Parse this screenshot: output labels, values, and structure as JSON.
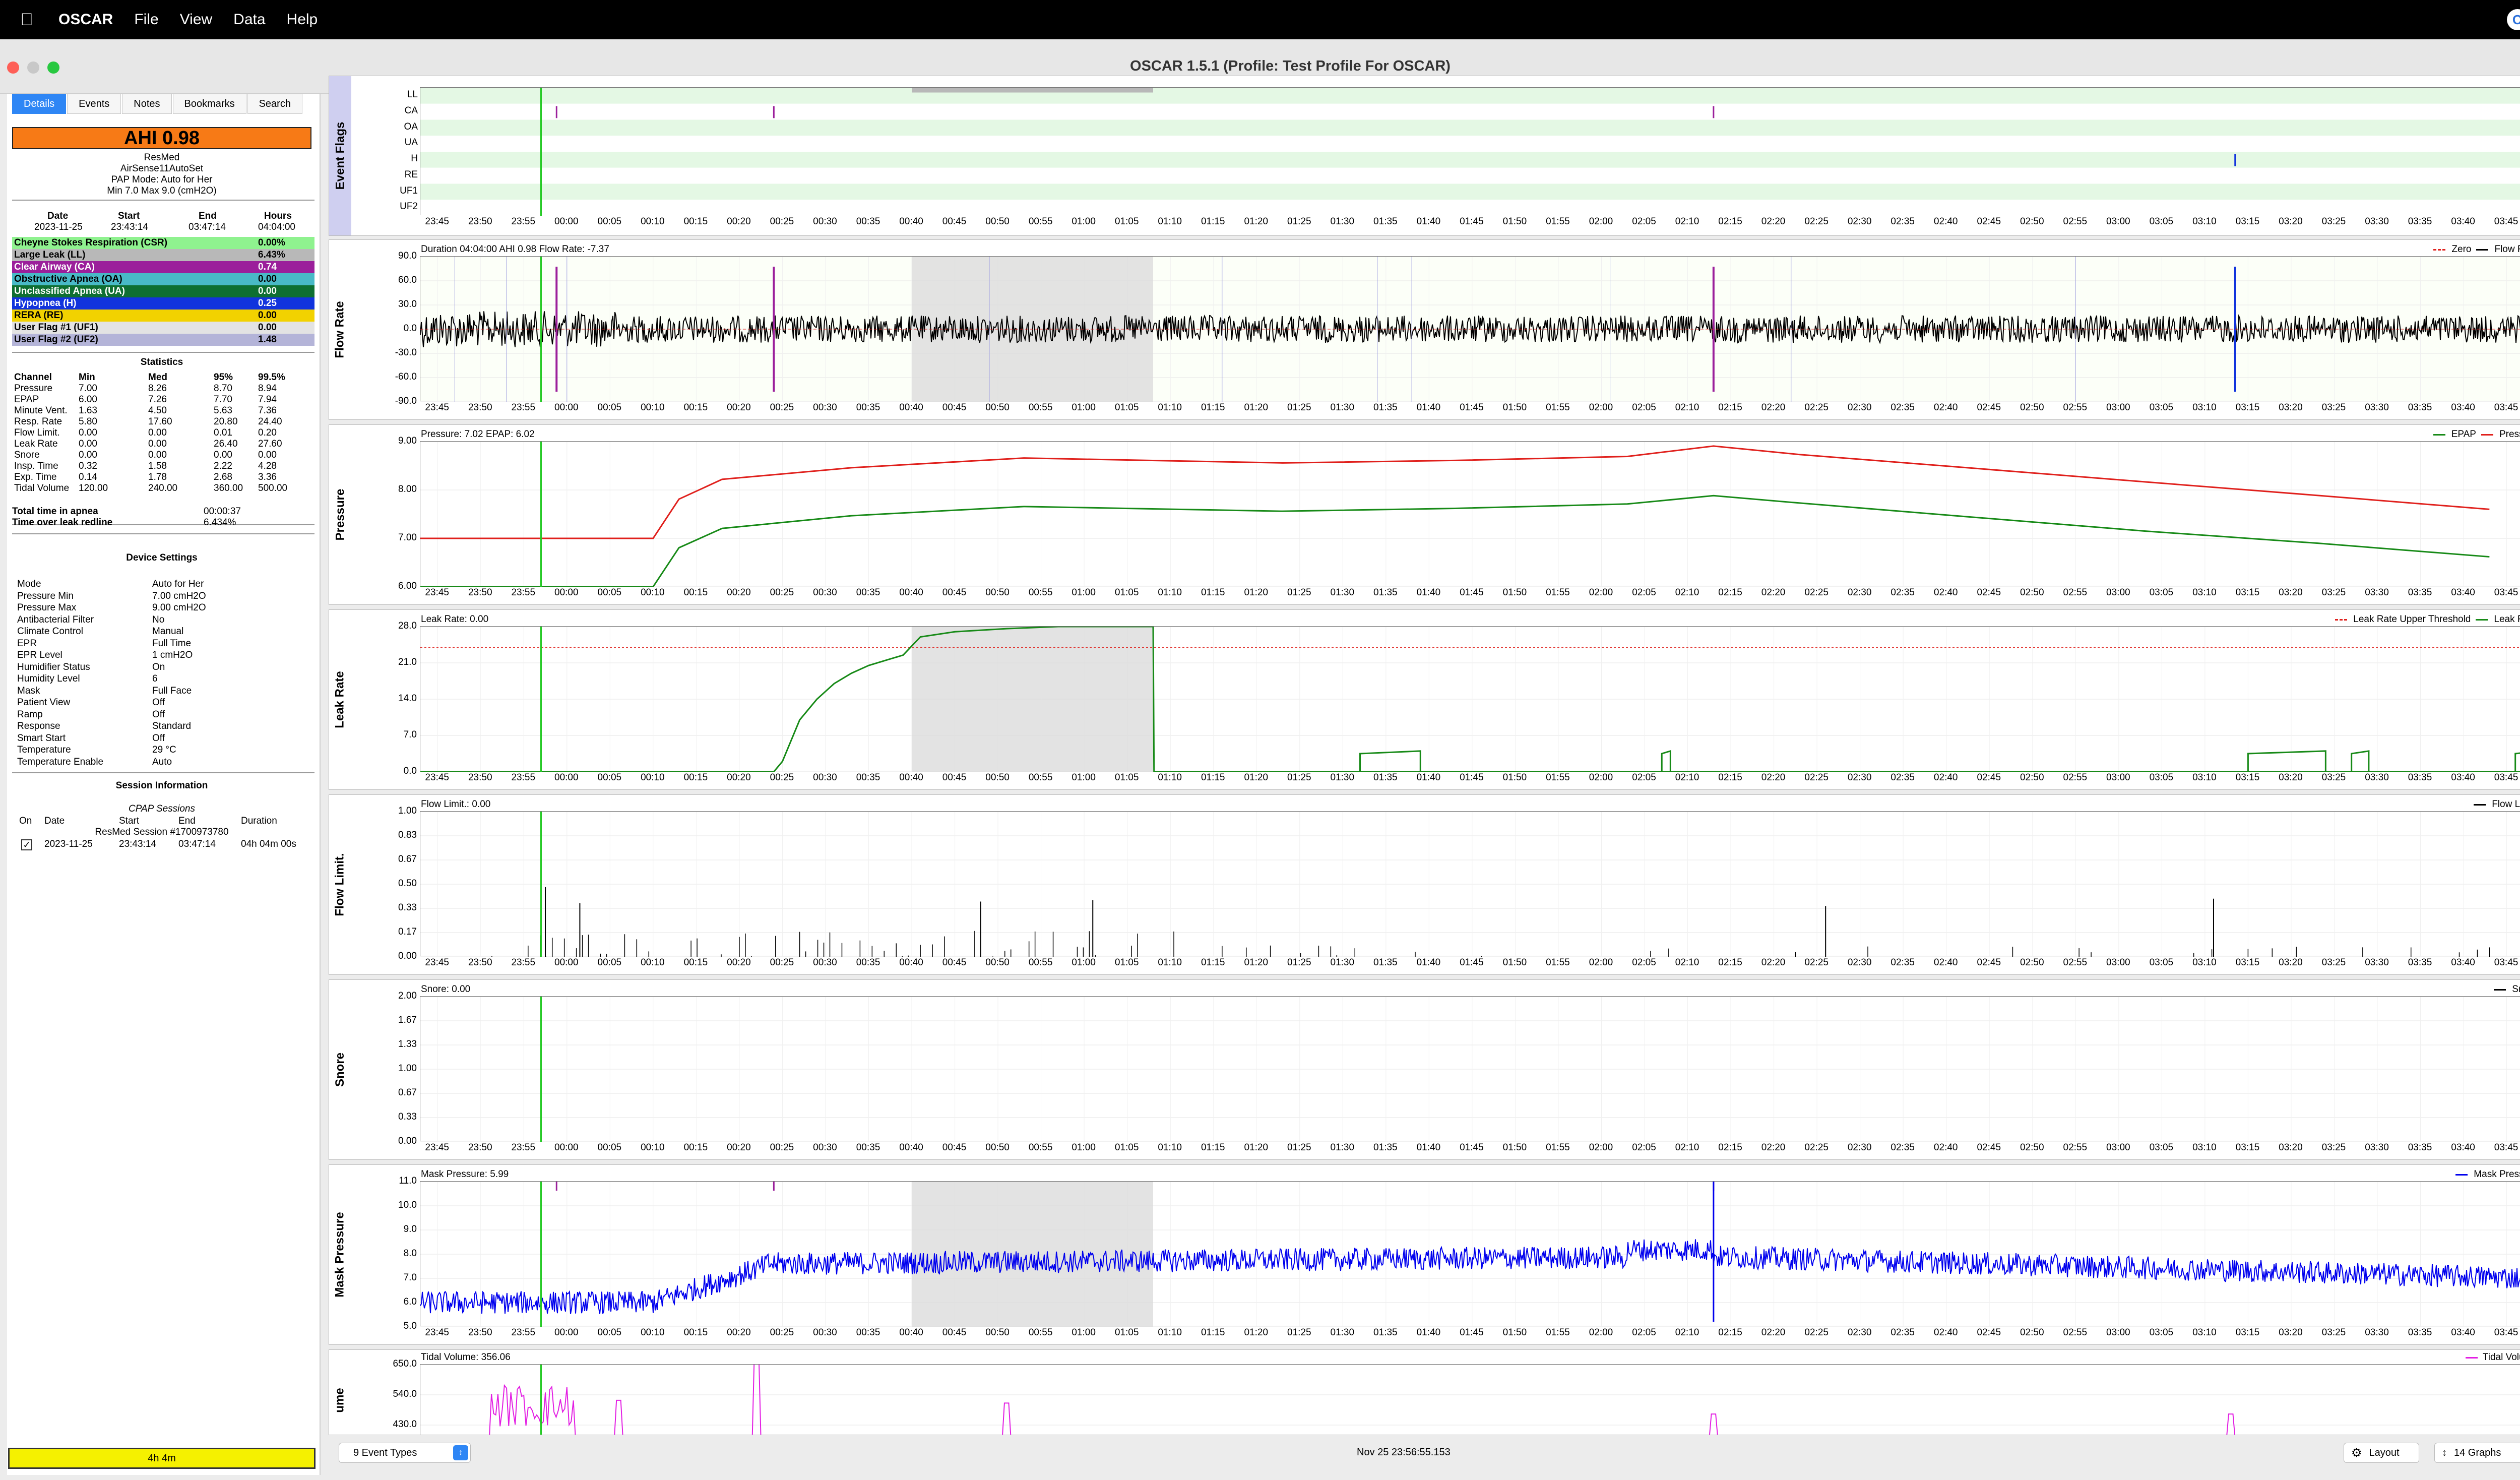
{
  "menubar": {
    "apple": "",
    "app": "OSCAR",
    "items": [
      "File",
      "View",
      "Data",
      "Help"
    ]
  },
  "window": {
    "title": "OSCAR 1.5.1 (Profile: Test Profile For OSCAR)"
  },
  "tabs": [
    "Details",
    "Events",
    "Notes",
    "Bookmarks",
    "Search"
  ],
  "summary": {
    "ahi": "AHI 0.98",
    "brand": "ResMed",
    "model": "AirSense11AutoSet",
    "pap_mode": "PAP Mode: Auto for Her",
    "minmax": "Min 7.0 Max 9.0 (cmH2O)",
    "date_headers": [
      "Date",
      "Start",
      "End",
      "Hours"
    ],
    "date_values": [
      "2023-11-25",
      "23:43:14",
      "03:47:14",
      "04:04:00"
    ]
  },
  "events": [
    {
      "label": "Cheyne Stokes Respiration (CSR)",
      "value": "0.00%",
      "color": "#8ff28f"
    },
    {
      "label": "Large Leak (LL)",
      "value": "6.43%",
      "color": "#b8b8b8"
    },
    {
      "label": "Clear Airway (CA)",
      "value": "0.74",
      "color": "#9b1f9b"
    },
    {
      "label": "Obstructive Apnea (OA)",
      "value": "0.00",
      "color": "#49b9c7"
    },
    {
      "label": "Unclassified Apnea (UA)",
      "value": "0.00",
      "color": "#0e6f32"
    },
    {
      "label": "Hypopnea (H)",
      "value": "0.25",
      "color": "#1133dd"
    },
    {
      "label": "RERA (RE)",
      "value": "0.00",
      "color": "#f2d200"
    },
    {
      "label": "User Flag #1 (UF1)",
      "value": "0.00",
      "color": "#e3e3e3"
    },
    {
      "label": "User Flag #2 (UF2)",
      "value": "1.48",
      "color": "#b4b4d8"
    }
  ],
  "statistics": {
    "title": "Statistics",
    "headers": [
      "Channel",
      "Min",
      "Med",
      "95%",
      "99.5%"
    ],
    "rows": [
      [
        "Pressure",
        "7.00",
        "8.26",
        "8.70",
        "8.94"
      ],
      [
        "EPAP",
        "6.00",
        "7.26",
        "7.70",
        "7.94"
      ],
      [
        "Minute Vent.",
        "1.63",
        "4.50",
        "5.63",
        "7.36"
      ],
      [
        "Resp. Rate",
        "5.80",
        "17.60",
        "20.80",
        "24.40"
      ],
      [
        "Flow Limit.",
        "0.00",
        "0.00",
        "0.01",
        "0.20"
      ],
      [
        "Leak Rate",
        "0.00",
        "0.00",
        "26.40",
        "27.60"
      ],
      [
        "Snore",
        "0.00",
        "0.00",
        "0.00",
        "0.00"
      ],
      [
        "Insp. Time",
        "0.32",
        "1.58",
        "2.22",
        "4.28"
      ],
      [
        "Exp. Time",
        "0.14",
        "1.78",
        "2.68",
        "3.36"
      ],
      [
        "Tidal Volume",
        "120.00",
        "240.00",
        "360.00",
        "500.00"
      ]
    ],
    "apnea_label": "Total time in apnea",
    "apnea_value": "00:00:37",
    "leak_label": "Time over leak redline",
    "leak_value": "6.434%"
  },
  "device": {
    "title": "Device Settings",
    "rows": [
      [
        "Mode",
        "Auto for Her"
      ],
      [
        "Pressure Min",
        "7.00 cmH2O"
      ],
      [
        "Pressure Max",
        "9.00 cmH2O"
      ],
      [
        "Antibacterial Filter",
        "No"
      ],
      [
        "Climate Control",
        "Manual"
      ],
      [
        "EPR",
        "Full Time"
      ],
      [
        "EPR Level",
        "1 cmH2O"
      ],
      [
        "Humidifier Status",
        "On"
      ],
      [
        "Humidity Level",
        "6"
      ],
      [
        "Mask",
        "Full Face"
      ],
      [
        "Patient View",
        "Off"
      ],
      [
        "Ramp",
        "Off"
      ],
      [
        "Response",
        "Standard"
      ],
      [
        "Smart Start",
        "Off"
      ],
      [
        "Temperature",
        "29 °C"
      ],
      [
        "Temperature Enable",
        "Auto"
      ]
    ]
  },
  "session": {
    "title": "Session Information",
    "subtitle": "CPAP Sessions",
    "headers": [
      "On",
      "Date",
      "Start",
      "End",
      "Duration"
    ],
    "session_name": "ResMed Session #1700973780",
    "row": {
      "date": "2023-11-25",
      "start": "23:43:14",
      "end": "03:47:14",
      "duration": "04h 04m 00s"
    }
  },
  "footer_left": "4h 4m",
  "x_ticks": [
    "23:45",
    "23:50",
    "23:55",
    "00:00",
    "00:05",
    "00:10",
    "00:15",
    "00:20",
    "00:25",
    "00:30",
    "00:35",
    "00:40",
    "00:45",
    "00:50",
    "00:55",
    "01:00",
    "01:05",
    "01:10",
    "01:15",
    "01:20",
    "01:25",
    "01:30",
    "01:35",
    "01:40",
    "01:45",
    "01:50",
    "01:55",
    "02:00",
    "02:05",
    "02:10",
    "02:15",
    "02:20",
    "02:25",
    "02:30",
    "02:35",
    "02:40",
    "02:45",
    "02:50",
    "02:55",
    "03:00",
    "03:05",
    "03:10",
    "03:15",
    "03:20",
    "03:25",
    "03:30",
    "03:35",
    "03:40",
    "03:45"
  ],
  "graphs": {
    "event_flags": {
      "label": "Event Flags",
      "rows": [
        "LL",
        "CA",
        "OA",
        "UA",
        "H",
        "RE",
        "UF1",
        "UF2"
      ]
    },
    "flow": {
      "label": "Flow Rate",
      "title": "Duration 04:04:00 AHI 0.98 Flow Rate: -7.37",
      "legend": [
        "Zero",
        "Flow Rate"
      ],
      "yticks": [
        "90.0",
        "60.0",
        "30.0",
        "0.0",
        "-30.0",
        "-60.0",
        "-90.0"
      ]
    },
    "pressure": {
      "label": "Pressure",
      "title": "Pressure: 7.02 EPAP: 6.02",
      "legend": [
        "EPAP",
        "Pressure"
      ],
      "yticks": [
        "9.00",
        "8.00",
        "7.00",
        "6.00"
      ]
    },
    "leak": {
      "label": "Leak Rate",
      "title": "Leak Rate: 0.00",
      "legend": [
        "Leak Rate Upper Threshold",
        "Leak Rate"
      ],
      "yticks": [
        "28.0",
        "21.0",
        "14.0",
        "7.0",
        "0.0"
      ]
    },
    "flowlimit": {
      "label": "Flow Limit.",
      "title": "Flow Limit.: 0.00",
      "legend": [
        "Flow Limit."
      ],
      "yticks": [
        "1.00",
        "0.83",
        "0.67",
        "0.50",
        "0.33",
        "0.17",
        "0.00"
      ]
    },
    "snore": {
      "label": "Snore",
      "title": "Snore: 0.00",
      "legend": [
        "Snore"
      ],
      "yticks": [
        "2.00",
        "1.67",
        "1.33",
        "1.00",
        "0.67",
        "0.33",
        "0.00"
      ]
    },
    "mask": {
      "label": "Mask Pressure",
      "title": "Mask Pressure: 5.99",
      "legend": [
        "Mask Pressure"
      ],
      "yticks": [
        "11.0",
        "10.0",
        "9.0",
        "8.0",
        "7.0",
        "6.0",
        "5.0"
      ]
    },
    "tidal": {
      "label": "ume",
      "title": "Tidal Volume: 356.06",
      "legend": [
        "Tidal Volume"
      ],
      "yticks": [
        "650.0",
        "540.0",
        "430.0"
      ]
    }
  },
  "statusbar": {
    "event_types": "9 Event Types",
    "time": "Nov 25 23:56:55.153",
    "layout": "Layout",
    "graphs": "14 Graphs"
  },
  "chart_data": [
    {
      "type": "line",
      "name": "Pressure",
      "x_unit": "minutes since 23:43",
      "series": [
        {
          "name": "Pressure",
          "color": "#e0201c",
          "x": [
            0,
            13,
            27,
            30,
            35,
            50,
            70,
            100,
            120,
            140,
            150,
            160,
            180,
            200,
            220,
            240
          ],
          "y": [
            7.0,
            7.0,
            7.0,
            7.8,
            8.2,
            8.45,
            8.65,
            8.55,
            8.6,
            8.7,
            8.9,
            8.75,
            8.45,
            8.15,
            7.9,
            7.6
          ]
        },
        {
          "name": "EPAP",
          "color": "#178a17",
          "x": [
            0,
            13,
            27,
            30,
            35,
            50,
            70,
            100,
            120,
            140,
            150,
            160,
            180,
            200,
            220,
            240
          ],
          "y": [
            6.0,
            6.0,
            6.0,
            6.8,
            7.2,
            7.45,
            7.65,
            7.55,
            7.6,
            7.7,
            7.9,
            7.75,
            7.45,
            7.15,
            6.9,
            6.6
          ]
        }
      ],
      "ylim": [
        6,
        9
      ]
    }
  ]
}
